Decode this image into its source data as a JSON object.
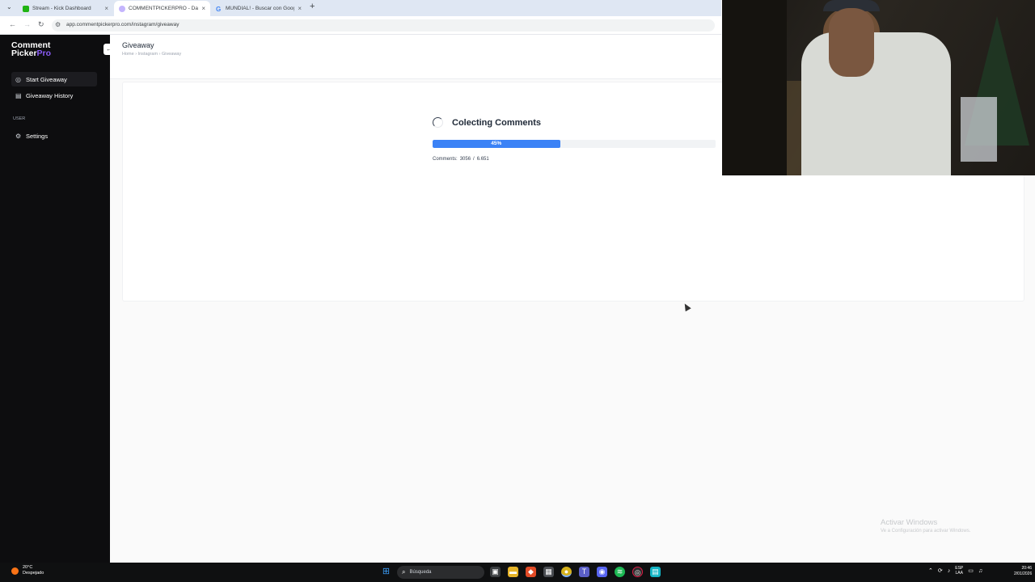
{
  "browser": {
    "tabs": [
      {
        "title": "Stream - Kick Dashboard",
        "favicon": "kick-favicon",
        "color": "#1fb313",
        "active": false
      },
      {
        "title": "COMMENTPICKERPRO - Dashb",
        "favicon": "commentpicker-favicon",
        "color": "#c4b5fd",
        "active": true
      },
      {
        "title": "MUNDIAL! - Buscar con Google",
        "favicon": "google-favicon",
        "color": "#4285f4",
        "active": false
      }
    ],
    "url": "app.commentpickerpro.com/instagram/giveaway"
  },
  "sidebar": {
    "logo_line1": "Comment",
    "logo_line2a": "Picker",
    "logo_line2b": "Pro",
    "items": [
      {
        "label": "Start Giveaway",
        "icon": "target-icon"
      },
      {
        "label": "Giveaway History",
        "icon": "history-icon"
      }
    ],
    "user_section": "USER",
    "settings_label": "Settings"
  },
  "page": {
    "title": "Giveaway",
    "breadcrumb": [
      "Home",
      "Instagram",
      "Giveaway"
    ]
  },
  "status": {
    "title": "Colecting Comments",
    "progress_percent": 45,
    "progress_label": "45%",
    "comments_label": "Comments:",
    "comments_collected": "3056",
    "comments_sep": "/",
    "comments_total": "6.651"
  },
  "watermark": {
    "line1": "Activar Windows",
    "line2": "Ve a Configuración para activar Windows."
  },
  "taskbar": {
    "weather_temp": "20°C",
    "weather_desc": "Despejado",
    "search_placeholder": "Búsqueda",
    "lang_line1": "ESP",
    "lang_line2": "LAA",
    "time": "20:46",
    "date": "2/01/2026"
  },
  "colors": {
    "accent": "#3b82f6",
    "brand": "#8b5cf6",
    "sidebar_bg": "#0d0d0f"
  }
}
